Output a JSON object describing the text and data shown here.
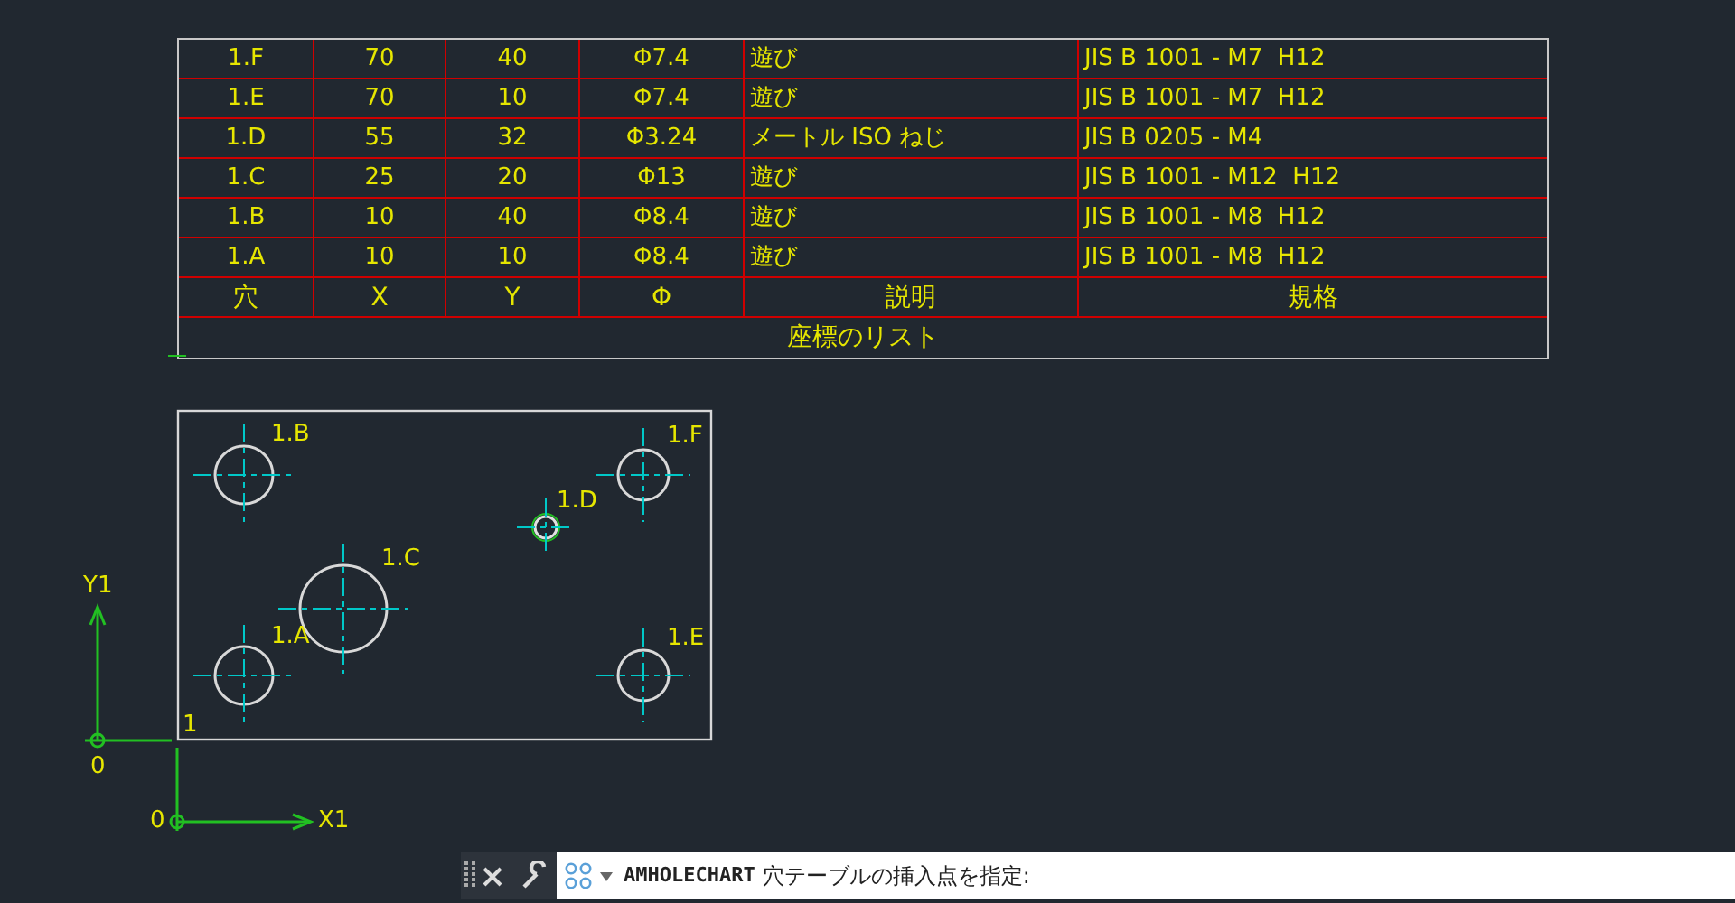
{
  "hole_table": {
    "title": "座標のリスト",
    "header": [
      "穴",
      "X",
      "Y",
      "Φ",
      "説明",
      "規格"
    ],
    "rows": [
      [
        "1.F",
        "70",
        "40",
        "Φ7.4",
        "遊び",
        "JIS B 1001 - M7  H12"
      ],
      [
        "1.E",
        "70",
        "10",
        "Φ7.4",
        "遊び",
        "JIS B 1001 - M7  H12"
      ],
      [
        "1.D",
        "55",
        "32",
        "Φ3.24",
        "メートル ISO ねじ",
        "JIS B 0205 - M4"
      ],
      [
        "1.C",
        "25",
        "20",
        "Φ13",
        "遊び",
        "JIS B 1001 - M12  H12"
      ],
      [
        "1.B",
        "10",
        "40",
        "Φ8.4",
        "遊び",
        "JIS B 1001 - M8  H12"
      ],
      [
        "1.A",
        "10",
        "10",
        "Φ8.4",
        "遊び",
        "JIS B 1001 - M8  H12"
      ]
    ]
  },
  "drawing": {
    "hole_labels": [
      "1.B",
      "1.F",
      "1.D",
      "1.C",
      "1.A",
      "1.E"
    ],
    "origin_label": "1",
    "axes": [
      {
        "label_y": "Y1",
        "label_origin": "0"
      },
      {
        "label_x": "X1",
        "label_origin": "0"
      }
    ]
  },
  "command_line": {
    "command": "AMHOLECHART",
    "prompt": "穴テーブルの挿入点を指定:"
  }
}
